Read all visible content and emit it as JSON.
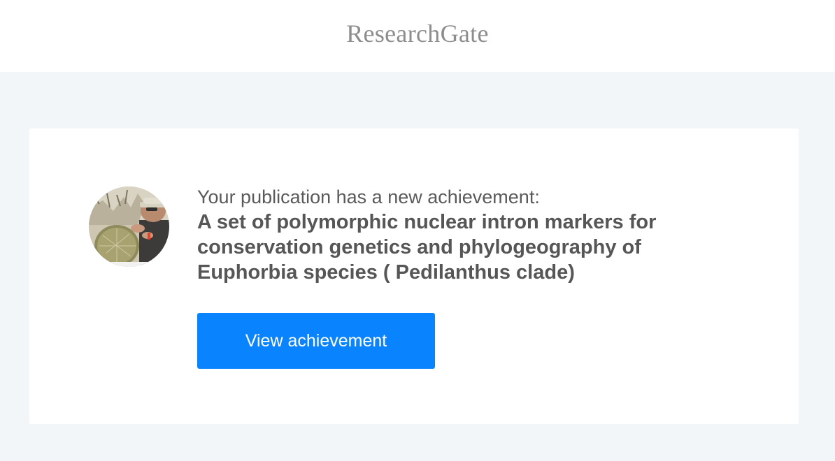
{
  "header": {
    "logo_text": "ResearchGate"
  },
  "notification": {
    "intro": "Your publication has a new achievement:",
    "publication_title": "A set of polymorphic nuclear intron markers for conservation genetics and phylogeography of Euphorbia species ( Pedilanthus clade)",
    "button_label": "View achievement"
  },
  "colors": {
    "page_background": "#f2f6f9",
    "card_background": "#ffffff",
    "button": "#0a84fe",
    "logo": "#8d8d8d",
    "text": "#565656"
  }
}
